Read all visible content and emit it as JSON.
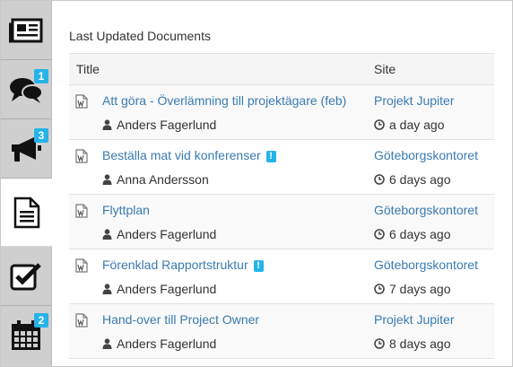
{
  "sidebar": {
    "items": [
      {
        "name": "news",
        "icon": "newspaper-icon",
        "badge": ""
      },
      {
        "name": "discussions",
        "icon": "chat-bubbles-icon",
        "badge": "1"
      },
      {
        "name": "announcements",
        "icon": "megaphone-icon",
        "badge": "3"
      },
      {
        "name": "documents",
        "icon": "document-icon",
        "badge": "",
        "active": true
      },
      {
        "name": "tasks",
        "icon": "checkbox-icon",
        "badge": ""
      },
      {
        "name": "calendar",
        "icon": "calendar-icon",
        "badge": "2"
      }
    ]
  },
  "main": {
    "heading": "Last Updated Documents",
    "columns": {
      "title": "Title",
      "site": "Site"
    },
    "rows": [
      {
        "title": "Att göra - Överlämning till projektägare (feb)",
        "warning": false,
        "author": "Anders Fagerlund",
        "site": "Projekt Jupiter",
        "updated": "a day ago"
      },
      {
        "title": "Beställa mat vid konferenser",
        "warning": true,
        "author": "Anna Andersson",
        "site": "Göteborgskontoret",
        "updated": "6 days ago"
      },
      {
        "title": "Flyttplan",
        "warning": false,
        "author": "Anders Fagerlund",
        "site": "Göteborgskontoret",
        "updated": "6 days ago"
      },
      {
        "title": "Förenklad Rapportstruktur",
        "warning": true,
        "author": "Anders Fagerlund",
        "site": "Göteborgskontoret",
        "updated": "7 days ago"
      },
      {
        "title": "Hand-over till Project Owner",
        "warning": false,
        "author": "Anders Fagerlund",
        "site": "Projekt Jupiter",
        "updated": "8 days ago"
      }
    ],
    "warning_glyph": "!"
  },
  "colors": {
    "accent": "#25b3e8",
    "link": "#3a7ab0",
    "sidebar": "#cfcfcf"
  }
}
